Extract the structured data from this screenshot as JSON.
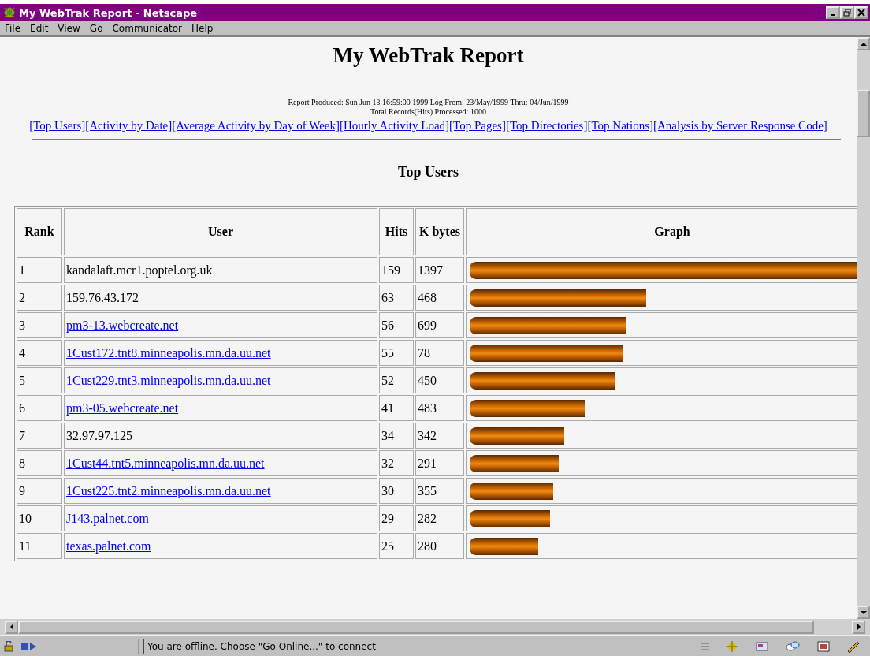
{
  "window": {
    "title": "My WebTrak Report - Netscape"
  },
  "menu": [
    "File",
    "Edit",
    "View",
    "Go",
    "Communicator",
    "Help"
  ],
  "page": {
    "title": "My WebTrak Report",
    "produced": "Report Produced: Sun Jun 13 16:59:00 1999 Log From: 23/May/1999 Thru: 04/Jun/1999",
    "records": "Total Records(Hits) Processed: 1000",
    "nav_links": [
      "[Top Users]",
      "[Activity by Date]",
      "[Average Activity by Day of Week]",
      "[Hourly Activity Load]",
      "[Top Pages]",
      "[Top Directories]",
      "[Top Nations]",
      "[Analysis by Server Response Code]"
    ],
    "section_title": "Top Users"
  },
  "table": {
    "columns": [
      "Rank",
      "User",
      "Hits",
      "K bytes",
      "Graph"
    ],
    "rows": [
      {
        "rank": "1",
        "user": "kandalaft.mcr1.poptel.org.uk",
        "link": false,
        "hits": "159",
        "kbytes": "1397",
        "level": 1
      },
      {
        "rank": "2",
        "user": "159.76.43.172",
        "link": false,
        "hits": "63",
        "kbytes": "468",
        "level": 0.436
      },
      {
        "rank": "3",
        "user": "pm3-13.webcreate.net",
        "link": true,
        "hits": "56",
        "kbytes": "699",
        "level": 0.386
      },
      {
        "rank": "4",
        "user": "1Cust172.tnt8.minneapolis.mn.da.uu.net",
        "link": true,
        "hits": "55",
        "kbytes": "78",
        "level": 0.38
      },
      {
        "rank": "5",
        "user": "1Cust229.tnt3.minneapolis.mn.da.uu.net",
        "link": true,
        "hits": "52",
        "kbytes": "450",
        "level": 0.358
      },
      {
        "rank": "6",
        "user": "pm3-05.webcreate.net",
        "link": true,
        "hits": "41",
        "kbytes": "483",
        "level": 0.284
      },
      {
        "rank": "7",
        "user": "32.97.97.125",
        "link": false,
        "hits": "34",
        "kbytes": "342",
        "level": 0.234
      },
      {
        "rank": "8",
        "user": "1Cust44.tnt5.minneapolis.mn.da.uu.net",
        "link": true,
        "hits": "32",
        "kbytes": "291",
        "level": 0.22
      },
      {
        "rank": "9",
        "user": "1Cust225.tnt2.minneapolis.mn.da.uu.net",
        "link": true,
        "hits": "30",
        "kbytes": "355",
        "level": 0.206
      },
      {
        "rank": "10",
        "user": "J143.palnet.com",
        "link": true,
        "hits": "29",
        "kbytes": "282",
        "level": 0.198
      },
      {
        "rank": "11",
        "user": "texas.palnet.com",
        "link": true,
        "hits": "25",
        "kbytes": "280",
        "level": 0.17
      }
    ]
  },
  "status_bar": {
    "message": "You are offline. Choose \"Go Online...\" to connect"
  }
}
